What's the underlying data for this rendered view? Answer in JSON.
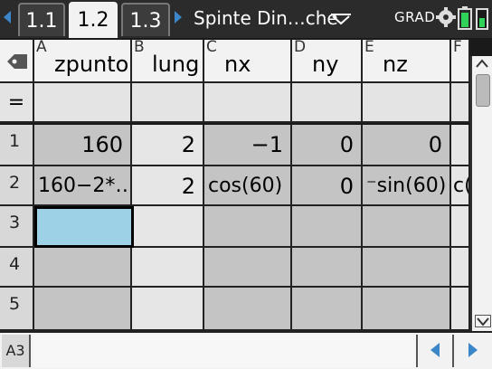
{
  "topbar": {
    "tabs": [
      {
        "label": "1.1",
        "active": false
      },
      {
        "label": "1.2",
        "active": true
      },
      {
        "label": "1.3",
        "active": false
      }
    ],
    "document_title": "Spinte Din…che",
    "angle_mode": "GRAD",
    "icons": {
      "nav_left": "triangle-left",
      "nav_right": "triangle-right",
      "doc_menu": "chevron-down",
      "settings": "gear",
      "battery": "battery"
    },
    "accent_color": "#3a86c8"
  },
  "sheet": {
    "header_icon": "tag-icon",
    "formula_row_label": "=",
    "columns": [
      {
        "letter": "A",
        "name": "zpunto"
      },
      {
        "letter": "B",
        "name": "lung"
      },
      {
        "letter": "C",
        "name": "nx"
      },
      {
        "letter": "D",
        "name": "ny"
      },
      {
        "letter": "E",
        "name": "nz"
      },
      {
        "letter": "F",
        "name": ""
      }
    ],
    "rows": [
      {
        "num": "1",
        "cells": [
          "160",
          "2",
          "−1",
          "0",
          "0",
          ""
        ]
      },
      {
        "num": "2",
        "cells": [
          "160−2*…",
          "2",
          "cos(60)",
          "0",
          "⁻sin(60)",
          "c("
        ]
      },
      {
        "num": "3",
        "cells": [
          "",
          "",
          "",
          "",
          "",
          ""
        ]
      },
      {
        "num": "4",
        "cells": [
          "",
          "",
          "",
          "",
          "",
          ""
        ]
      },
      {
        "num": "5",
        "cells": [
          "",
          "",
          "",
          "",
          "",
          ""
        ]
      }
    ],
    "selected_cell": "A3",
    "selected_color": "#9dd1e6"
  },
  "bottombar": {
    "cell_reference": "A3",
    "entry_value": ""
  }
}
